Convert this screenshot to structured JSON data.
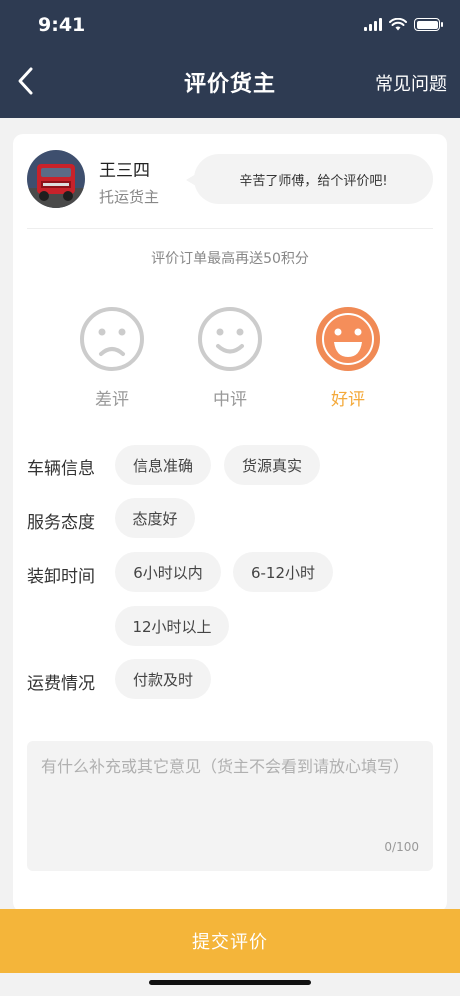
{
  "status_bar": {
    "time": "9:41"
  },
  "nav": {
    "title": "评价货主",
    "faq": "常见问题"
  },
  "owner": {
    "name": "王三四",
    "role": "托运货主",
    "bubble": "辛苦了师傅，给个评价吧!"
  },
  "bonus_text": "评价订单最高再送50积分",
  "ratings": [
    {
      "label": "差评",
      "selected": false
    },
    {
      "label": "中评",
      "selected": false
    },
    {
      "label": "好评",
      "selected": true
    }
  ],
  "categories": [
    {
      "label": "车辆信息",
      "tags": [
        "信息准确",
        "货源真实"
      ]
    },
    {
      "label": "服务态度",
      "tags": [
        "态度好"
      ]
    },
    {
      "label": "装卸时间",
      "tags": [
        "6小时以内",
        "6-12小时",
        "12小时以上"
      ]
    },
    {
      "label": "运费情况",
      "tags": [
        "付款及时"
      ]
    }
  ],
  "comment": {
    "placeholder": "有什么补充或其它意见（货主不会看到请放心填写）",
    "counter": "0/100"
  },
  "submit_label": "提交评价",
  "colors": {
    "header_bg": "#2e3b52",
    "accent": "#f4b53a",
    "active_face": "#f08a55",
    "inactive_face": "#cccccc"
  }
}
